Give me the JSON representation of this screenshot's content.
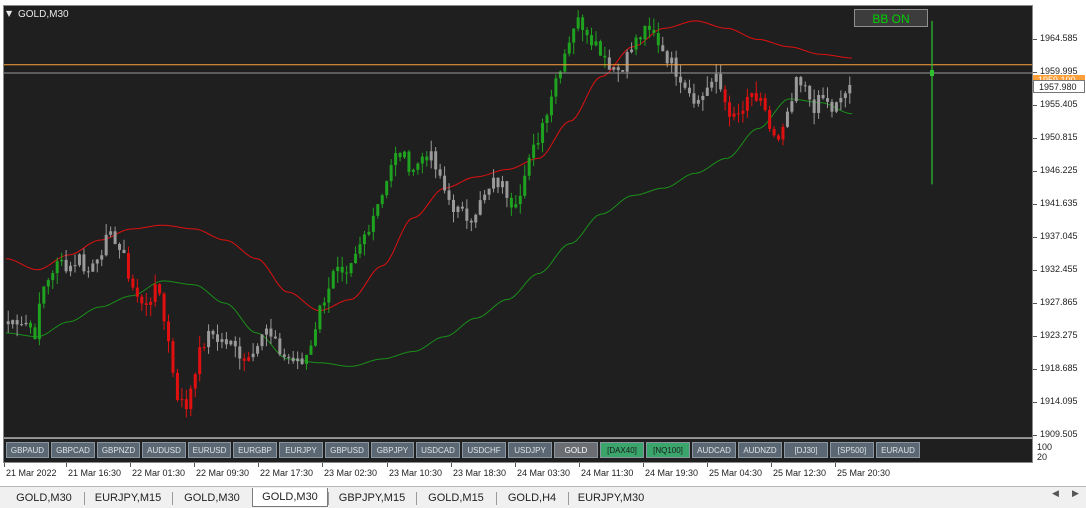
{
  "chart": {
    "title": "GOLD,M30",
    "bb_button_label": "BB ON",
    "current_price": "1957.980",
    "orange_level_label": "1959.100",
    "colors": {
      "background": "#1f1f1f",
      "bull": "#1fa21f",
      "bear": "#e01010",
      "neutral": "#9a9a9a",
      "upper_band": "#e01010",
      "lower_band": "#1a8f1a",
      "level_line": "#ff9f3a",
      "bid_line": "#9a9a9a"
    }
  },
  "price_axis": {
    "labels": [
      "1964.585",
      "1959.995",
      "1955.405",
      "1950.815",
      "1946.225",
      "1941.635",
      "1937.045",
      "1932.455",
      "1927.865",
      "1923.275",
      "1918.685",
      "1914.095",
      "1909.505"
    ],
    "min": 1909.0,
    "max": 1967.0
  },
  "sub_window": {
    "scale_labels": [
      "100",
      "20"
    ],
    "symbol_buttons": [
      {
        "label": "GBPAUD",
        "style": "normal"
      },
      {
        "label": "GBPCAD",
        "style": "normal"
      },
      {
        "label": "GBPNZD",
        "style": "normal"
      },
      {
        "label": "AUDUSD",
        "style": "normal"
      },
      {
        "label": "EURUSD",
        "style": "normal"
      },
      {
        "label": "EURGBP",
        "style": "normal"
      },
      {
        "label": "EURJPY",
        "style": "normal"
      },
      {
        "label": "GBPUSD",
        "style": "normal"
      },
      {
        "label": "GBPJPY",
        "style": "normal"
      },
      {
        "label": "USDCAD",
        "style": "normal"
      },
      {
        "label": "USDCHF",
        "style": "normal"
      },
      {
        "label": "USDJPY",
        "style": "normal"
      },
      {
        "label": "GOLD",
        "style": "active"
      },
      {
        "label": "[DAX40]",
        "style": "green"
      },
      {
        "label": "[NQ100]",
        "style": "green"
      },
      {
        "label": "AUDCAD",
        "style": "normal"
      },
      {
        "label": "AUDNZD",
        "style": "normal"
      },
      {
        "label": "[DJ30]",
        "style": "normal"
      },
      {
        "label": "[SP500]",
        "style": "normal"
      },
      {
        "label": "EURAUD",
        "style": "normal"
      }
    ]
  },
  "time_axis": {
    "labels": [
      "21 Mar 2022",
      "21 Mar 16:30",
      "22 Mar 01:30",
      "22 Mar 09:30",
      "22 Mar 17:30",
      "23 Mar 02:30",
      "23 Mar 10:30",
      "23 Mar 18:30",
      "24 Mar 03:30",
      "24 Mar 11:30",
      "24 Mar 19:30",
      "25 Mar 04:30",
      "25 Mar 12:30",
      "25 Mar 20:30"
    ]
  },
  "tabs": [
    {
      "label": "GOLD,M30",
      "active": false
    },
    {
      "label": "EURJPY,M15",
      "active": false
    },
    {
      "label": "GOLD,M30",
      "active": false
    },
    {
      "label": "GOLD,M30",
      "active": true
    },
    {
      "label": "GBPJPY,M15",
      "active": false
    },
    {
      "label": "GOLD,M15",
      "active": false
    },
    {
      "label": "GOLD,H4",
      "active": false
    },
    {
      "label": "EURJPY,M30",
      "active": false
    }
  ],
  "icons": {
    "title_menu": "triangle-down-icon",
    "scroll_left": "triangle-left-icon",
    "scroll_right": "triangle-right-icon"
  },
  "chart_data": {
    "type": "candlestick",
    "anchors": [
      [
        1924.2,
        "n"
      ],
      [
        1925.0,
        "n"
      ],
      [
        1924.5,
        "n"
      ],
      [
        1923.0,
        "g"
      ],
      [
        1929.0,
        "g"
      ],
      [
        1931.5,
        "g"
      ],
      [
        1932.5,
        "g"
      ],
      [
        1932.0,
        "n"
      ],
      [
        1933.3,
        "n"
      ],
      [
        1931.0,
        "n"
      ],
      [
        1933.5,
        "n"
      ],
      [
        1935.2,
        "n"
      ],
      [
        1936.0,
        "n"
      ],
      [
        1933.0,
        "n"
      ],
      [
        1929.5,
        "r"
      ],
      [
        1926.5,
        "r"
      ],
      [
        1927.8,
        "r"
      ],
      [
        1929.0,
        "r"
      ],
      [
        1922.5,
        "r"
      ],
      [
        1915.0,
        "r"
      ],
      [
        1912.5,
        "r"
      ],
      [
        1918.0,
        "r"
      ],
      [
        1921.5,
        "r"
      ],
      [
        1923.0,
        "n"
      ],
      [
        1922.0,
        "n"
      ],
      [
        1921.5,
        "n"
      ],
      [
        1920.5,
        "n"
      ],
      [
        1919.5,
        "r"
      ],
      [
        1922.0,
        "n"
      ],
      [
        1923.5,
        "n"
      ],
      [
        1921.5,
        "n"
      ],
      [
        1920.0,
        "n"
      ],
      [
        1919.5,
        "n"
      ],
      [
        1918.5,
        "n"
      ],
      [
        1921.0,
        "g"
      ],
      [
        1925.5,
        "g"
      ],
      [
        1929.0,
        "g"
      ],
      [
        1931.5,
        "g"
      ],
      [
        1929.5,
        "g"
      ],
      [
        1932.5,
        "g"
      ],
      [
        1935.5,
        "g"
      ],
      [
        1938.5,
        "g"
      ],
      [
        1941.5,
        "g"
      ],
      [
        1944.5,
        "g"
      ],
      [
        1947.5,
        "g"
      ],
      [
        1946.0,
        "g"
      ],
      [
        1945.0,
        "g"
      ],
      [
        1947.5,
        "g"
      ],
      [
        1946.0,
        "n"
      ],
      [
        1942.5,
        "n"
      ],
      [
        1940.5,
        "n"
      ],
      [
        1939.0,
        "n"
      ],
      [
        1938.5,
        "n"
      ],
      [
        1940.0,
        "n"
      ],
      [
        1941.5,
        "n"
      ],
      [
        1943.5,
        "n"
      ],
      [
        1942.5,
        "n"
      ],
      [
        1940.5,
        "g"
      ],
      [
        1943.0,
        "g"
      ],
      [
        1946.5,
        "g"
      ],
      [
        1950.0,
        "g"
      ],
      [
        1954.0,
        "g"
      ],
      [
        1958.0,
        "g"
      ],
      [
        1961.5,
        "g"
      ],
      [
        1965.0,
        "g"
      ],
      [
        1964.5,
        "g"
      ],
      [
        1962.5,
        "g"
      ],
      [
        1961.0,
        "g"
      ],
      [
        1959.0,
        "n"
      ],
      [
        1958.5,
        "n"
      ],
      [
        1960.5,
        "n"
      ],
      [
        1962.5,
        "g"
      ],
      [
        1963.5,
        "g"
      ],
      [
        1963.0,
        "g"
      ],
      [
        1961.0,
        "n"
      ],
      [
        1959.0,
        "n"
      ],
      [
        1957.5,
        "n"
      ],
      [
        1955.5,
        "n"
      ],
      [
        1954.0,
        "n"
      ],
      [
        1956.5,
        "n"
      ],
      [
        1957.0,
        "n"
      ],
      [
        1954.0,
        "r"
      ],
      [
        1951.5,
        "r"
      ],
      [
        1953.0,
        "r"
      ],
      [
        1955.0,
        "r"
      ],
      [
        1953.5,
        "r"
      ],
      [
        1950.5,
        "r"
      ],
      [
        1948.5,
        "r"
      ],
      [
        1952.0,
        "n"
      ],
      [
        1956.5,
        "n"
      ],
      [
        1955.5,
        "n"
      ],
      [
        1953.5,
        "n"
      ],
      [
        1954.5,
        "n"
      ],
      [
        1953.0,
        "n"
      ],
      [
        1954.0,
        "n"
      ],
      [
        1956.5,
        "n"
      ]
    ],
    "band_upper_anchors": [
      1933.0,
      1931.5,
      1933.5,
      1935.5,
      1937.0,
      1937.5,
      1937.0,
      1935.5,
      1933.0,
      1928.5,
      1926.0,
      1927.5,
      1932.0,
      1938.5,
      1942.5,
      1944.0,
      1945.0,
      1946.5,
      1951.5,
      1957.5,
      1961.5,
      1964.0,
      1965.0,
      1964.0,
      1962.5,
      1961.5,
      1960.5,
      1960.0
    ],
    "band_lower_anchors": [
      1923.0,
      1922.5,
      1924.5,
      1926.5,
      1928.0,
      1930.0,
      1929.5,
      1927.0,
      1923.0,
      1919.5,
      1919.0,
      1918.5,
      1919.5,
      1920.5,
      1922.5,
      1925.0,
      1927.5,
      1931.0,
      1935.0,
      1939.0,
      1941.5,
      1942.5,
      1944.5,
      1946.5,
      1950.5,
      1954.5,
      1954.0,
      1952.5
    ],
    "last_price": 1957.98,
    "orange_level": 1959.1,
    "forecast_bar": {
      "high": 1965.0,
      "low": 1943.0,
      "value": 1957.98
    }
  }
}
